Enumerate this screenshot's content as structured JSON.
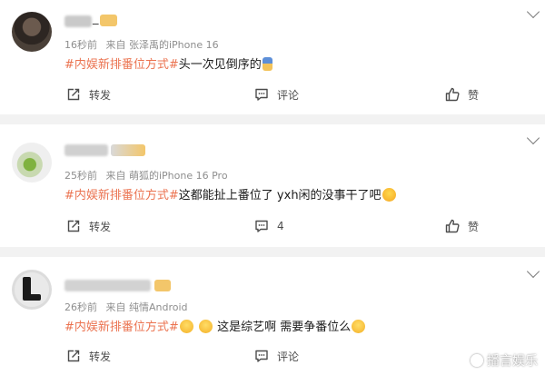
{
  "posts": [
    {
      "name_suffix": "_",
      "time": "16秒前",
      "source": "来自 张泽禹的iPhone 16",
      "hashtag": "#内娱新排番位方式#",
      "text": "头一次见倒序的",
      "actions": {
        "repost": "转发",
        "comment": "评论",
        "like": "赞"
      }
    },
    {
      "time": "25秒前",
      "source": "来自 萌狐的iPhone 16 Pro",
      "hashtag": "#内娱新排番位方式#",
      "text": "这都能扯上番位了 yxh闲的没事干了吧",
      "actions": {
        "repost": "转发",
        "comment": "4",
        "like": "赞"
      }
    },
    {
      "time": "26秒前",
      "source": "来自 纯情Android",
      "hashtag": "#内娱新排番位方式#",
      "text_a": "这是综艺啊 需要争番位么",
      "actions": {
        "repost": "转发",
        "comment": "评论",
        "like": "赞"
      }
    }
  ],
  "watermark": "播言娱乐",
  "icons": [
    "more-chevron-icon",
    "repost-icon",
    "comment-icon",
    "like-icon",
    "laugh-emoji-icon",
    "shush-emoji-icon"
  ]
}
